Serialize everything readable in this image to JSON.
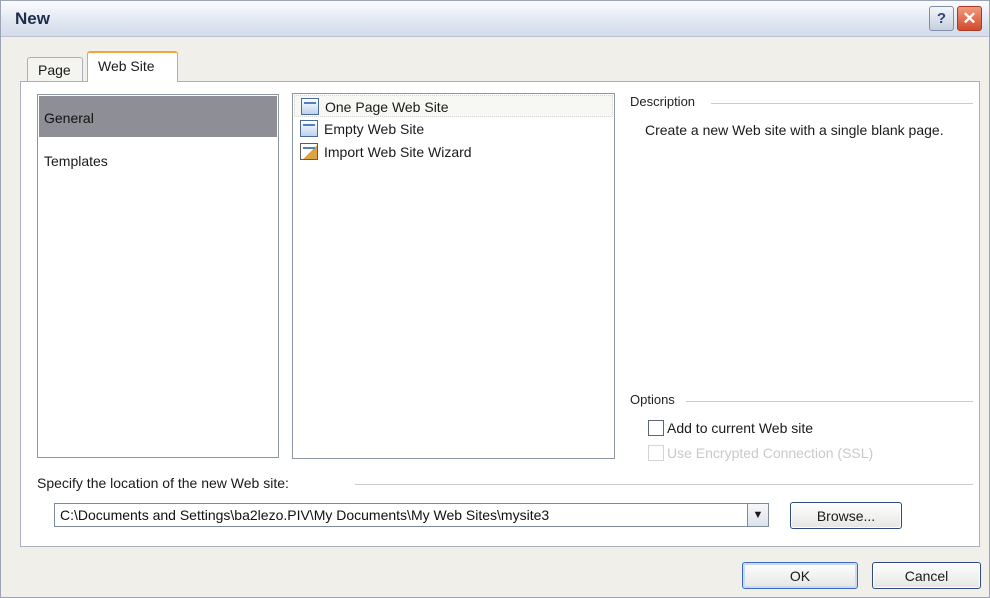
{
  "window": {
    "title": "New"
  },
  "title_buttons": {
    "help": "?",
    "close": "✕"
  },
  "tabs": [
    {
      "label": "Page",
      "active": false
    },
    {
      "label": "Web Site",
      "active": true
    }
  ],
  "categories": [
    {
      "label": "General",
      "selected": true
    },
    {
      "label": "Templates",
      "selected": false
    }
  ],
  "templates": [
    {
      "label": "One Page Web Site",
      "icon": "web-page-icon",
      "selected": true
    },
    {
      "label": "Empty Web Site",
      "icon": "web-page-icon",
      "selected": false
    },
    {
      "label": "Import Web Site Wizard",
      "icon": "wizard-icon",
      "selected": false
    }
  ],
  "description": {
    "label": "Description",
    "text": "Create a new Web site with a single blank page."
  },
  "options": {
    "label": "Options",
    "add_to_current": {
      "label": "Add to current Web site",
      "checked": false,
      "enabled": true
    },
    "encrypted": {
      "label": "Use Encrypted Connection (SSL)",
      "checked": false,
      "enabled": false
    }
  },
  "location": {
    "label": "Specify the location of the new Web site:",
    "value": "C:\\Documents and Settings\\ba2lezo.PIV\\My Documents\\My Web Sites\\mysite3",
    "browse_label": "Browse..."
  },
  "buttons": {
    "ok": "OK",
    "cancel": "Cancel"
  }
}
